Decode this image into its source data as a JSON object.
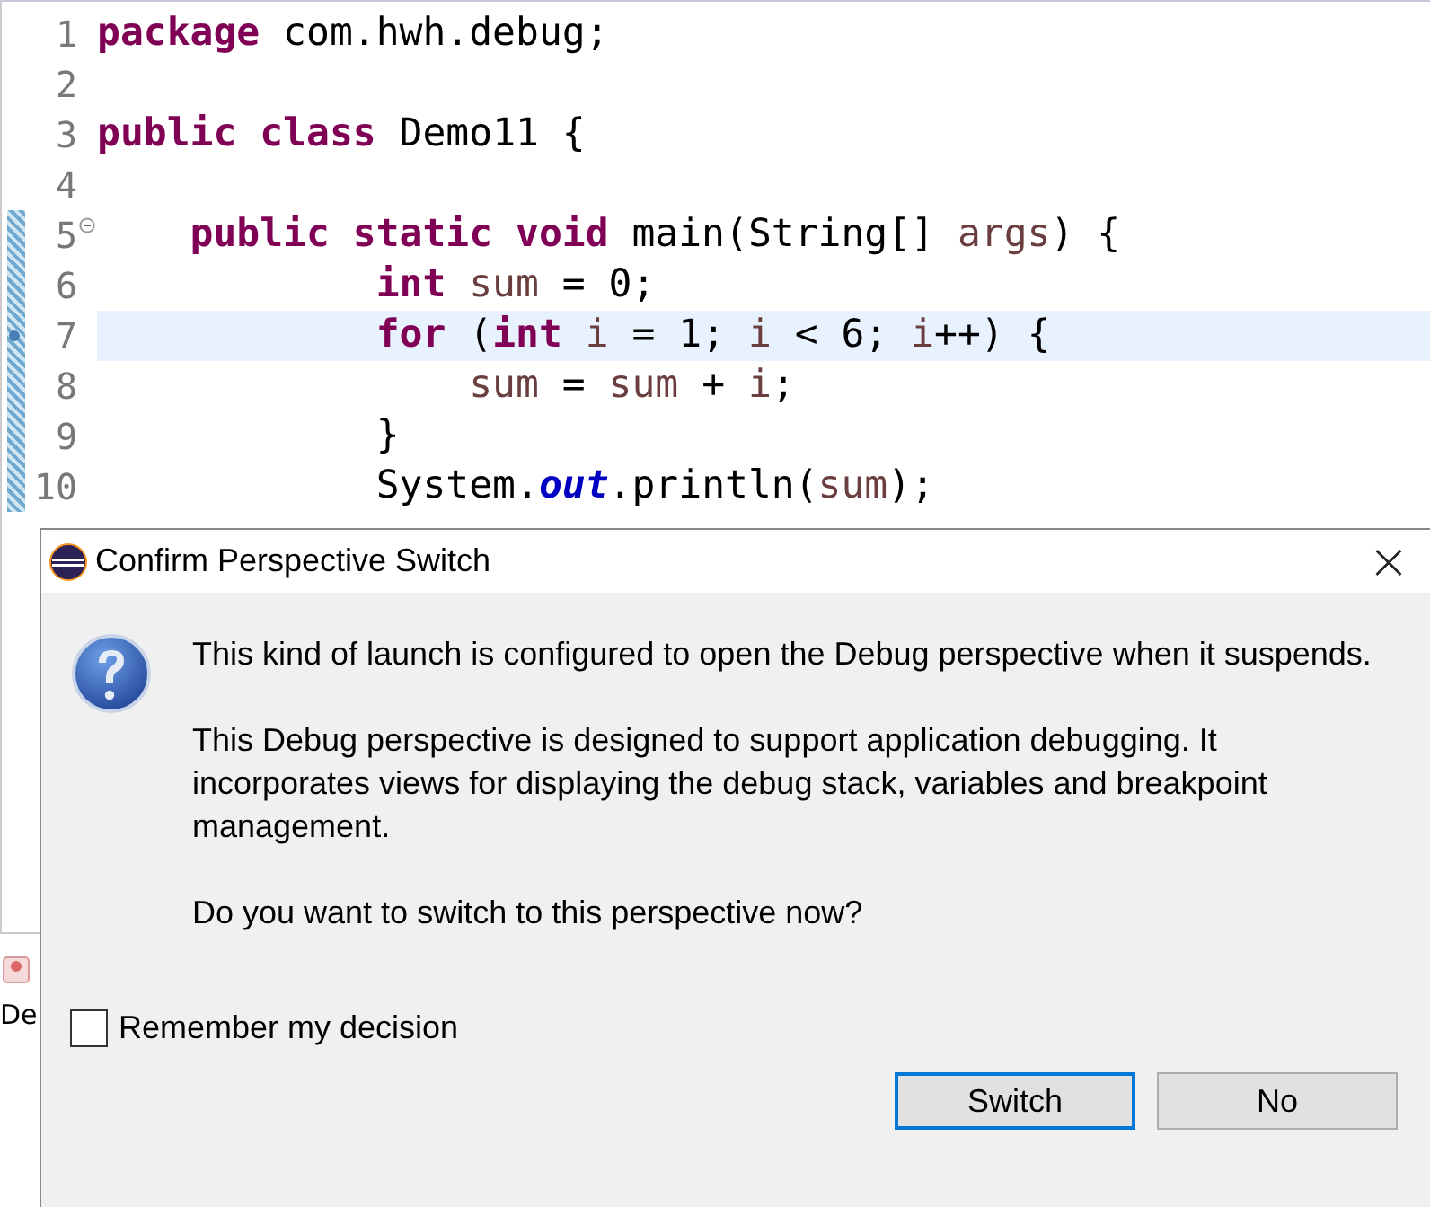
{
  "editor": {
    "lines": [
      {
        "number": "1",
        "changed": false,
        "fold": false,
        "current": false,
        "tokens": [
          {
            "kind": "keyword",
            "text": "package"
          },
          {
            "kind": "plain",
            "text": " com.hwh.debug;"
          }
        ]
      },
      {
        "number": "2",
        "changed": false,
        "fold": false,
        "current": false
      },
      {
        "number": "3",
        "changed": false,
        "fold": false,
        "current": false,
        "tokens": [
          {
            "kind": "keyword",
            "text": "public class"
          },
          {
            "kind": "plain",
            "text": " Demo11 {"
          }
        ]
      },
      {
        "number": "4",
        "changed": false,
        "fold": false,
        "current": false
      },
      {
        "number": "5",
        "changed": true,
        "fold": true,
        "current": false,
        "tokens": [
          {
            "kind": "keyword",
            "text": "    public static void"
          },
          {
            "kind": "plain",
            "text": " main(String[] "
          },
          {
            "kind": "local",
            "text": "args"
          },
          {
            "kind": "plain",
            "text": ") {"
          }
        ]
      },
      {
        "number": "6",
        "changed": true,
        "fold": false,
        "current": false,
        "tokens": [
          {
            "kind": "keyword",
            "text": "            int"
          },
          {
            "kind": "local",
            "text": " sum"
          },
          {
            "kind": "plain",
            "text": " = 0;"
          }
        ]
      },
      {
        "number": "7",
        "changed": true,
        "fold": false,
        "current": true,
        "tokens": [
          {
            "kind": "keyword",
            "text": "            for"
          },
          {
            "kind": "plain",
            "text": " ("
          },
          {
            "kind": "keyword",
            "text": "int"
          },
          {
            "kind": "local",
            "text": " i"
          },
          {
            "kind": "plain",
            "text": " = 1; "
          },
          {
            "kind": "local",
            "text": "i"
          },
          {
            "kind": "plain",
            "text": " < 6; "
          },
          {
            "kind": "local",
            "text": "i"
          },
          {
            "kind": "plain",
            "text": "++) {"
          }
        ]
      },
      {
        "number": "8",
        "changed": true,
        "fold": false,
        "current": false,
        "tokens": [
          {
            "kind": "local",
            "text": "                sum"
          },
          {
            "kind": "plain",
            "text": " = "
          },
          {
            "kind": "local",
            "text": "sum"
          },
          {
            "kind": "plain",
            "text": " + "
          },
          {
            "kind": "local",
            "text": "i"
          },
          {
            "kind": "plain",
            "text": ";"
          }
        ]
      },
      {
        "number": "9",
        "changed": true,
        "fold": false,
        "current": false,
        "tokens": [
          {
            "kind": "plain",
            "text": "            }"
          }
        ]
      },
      {
        "number": "10",
        "changed": true,
        "fold": false,
        "current": false,
        "tokens": [
          {
            "kind": "plain",
            "text": "            System."
          },
          {
            "kind": "field",
            "text": "out"
          },
          {
            "kind": "plain",
            "text": ".println("
          },
          {
            "kind": "local",
            "text": "sum"
          },
          {
            "kind": "plain",
            "text": ");"
          }
        ]
      }
    ]
  },
  "side_panel": {
    "tab_label": "De"
  },
  "dialog": {
    "title": "Confirm Perspective Switch",
    "close": "×",
    "paragraphs": [
      "This kind of launch is configured to open the Debug perspective when it suspends.",
      "This Debug perspective is designed to support application debugging. It incorporates views for displaying the debug stack, variables and breakpoint management.",
      "Do you want to switch to this perspective now?"
    ],
    "remember": {
      "label": "Remember my decision",
      "checked": false
    },
    "buttons": [
      {
        "label": "Switch",
        "default": true
      },
      {
        "label": "No",
        "default": false
      }
    ]
  }
}
